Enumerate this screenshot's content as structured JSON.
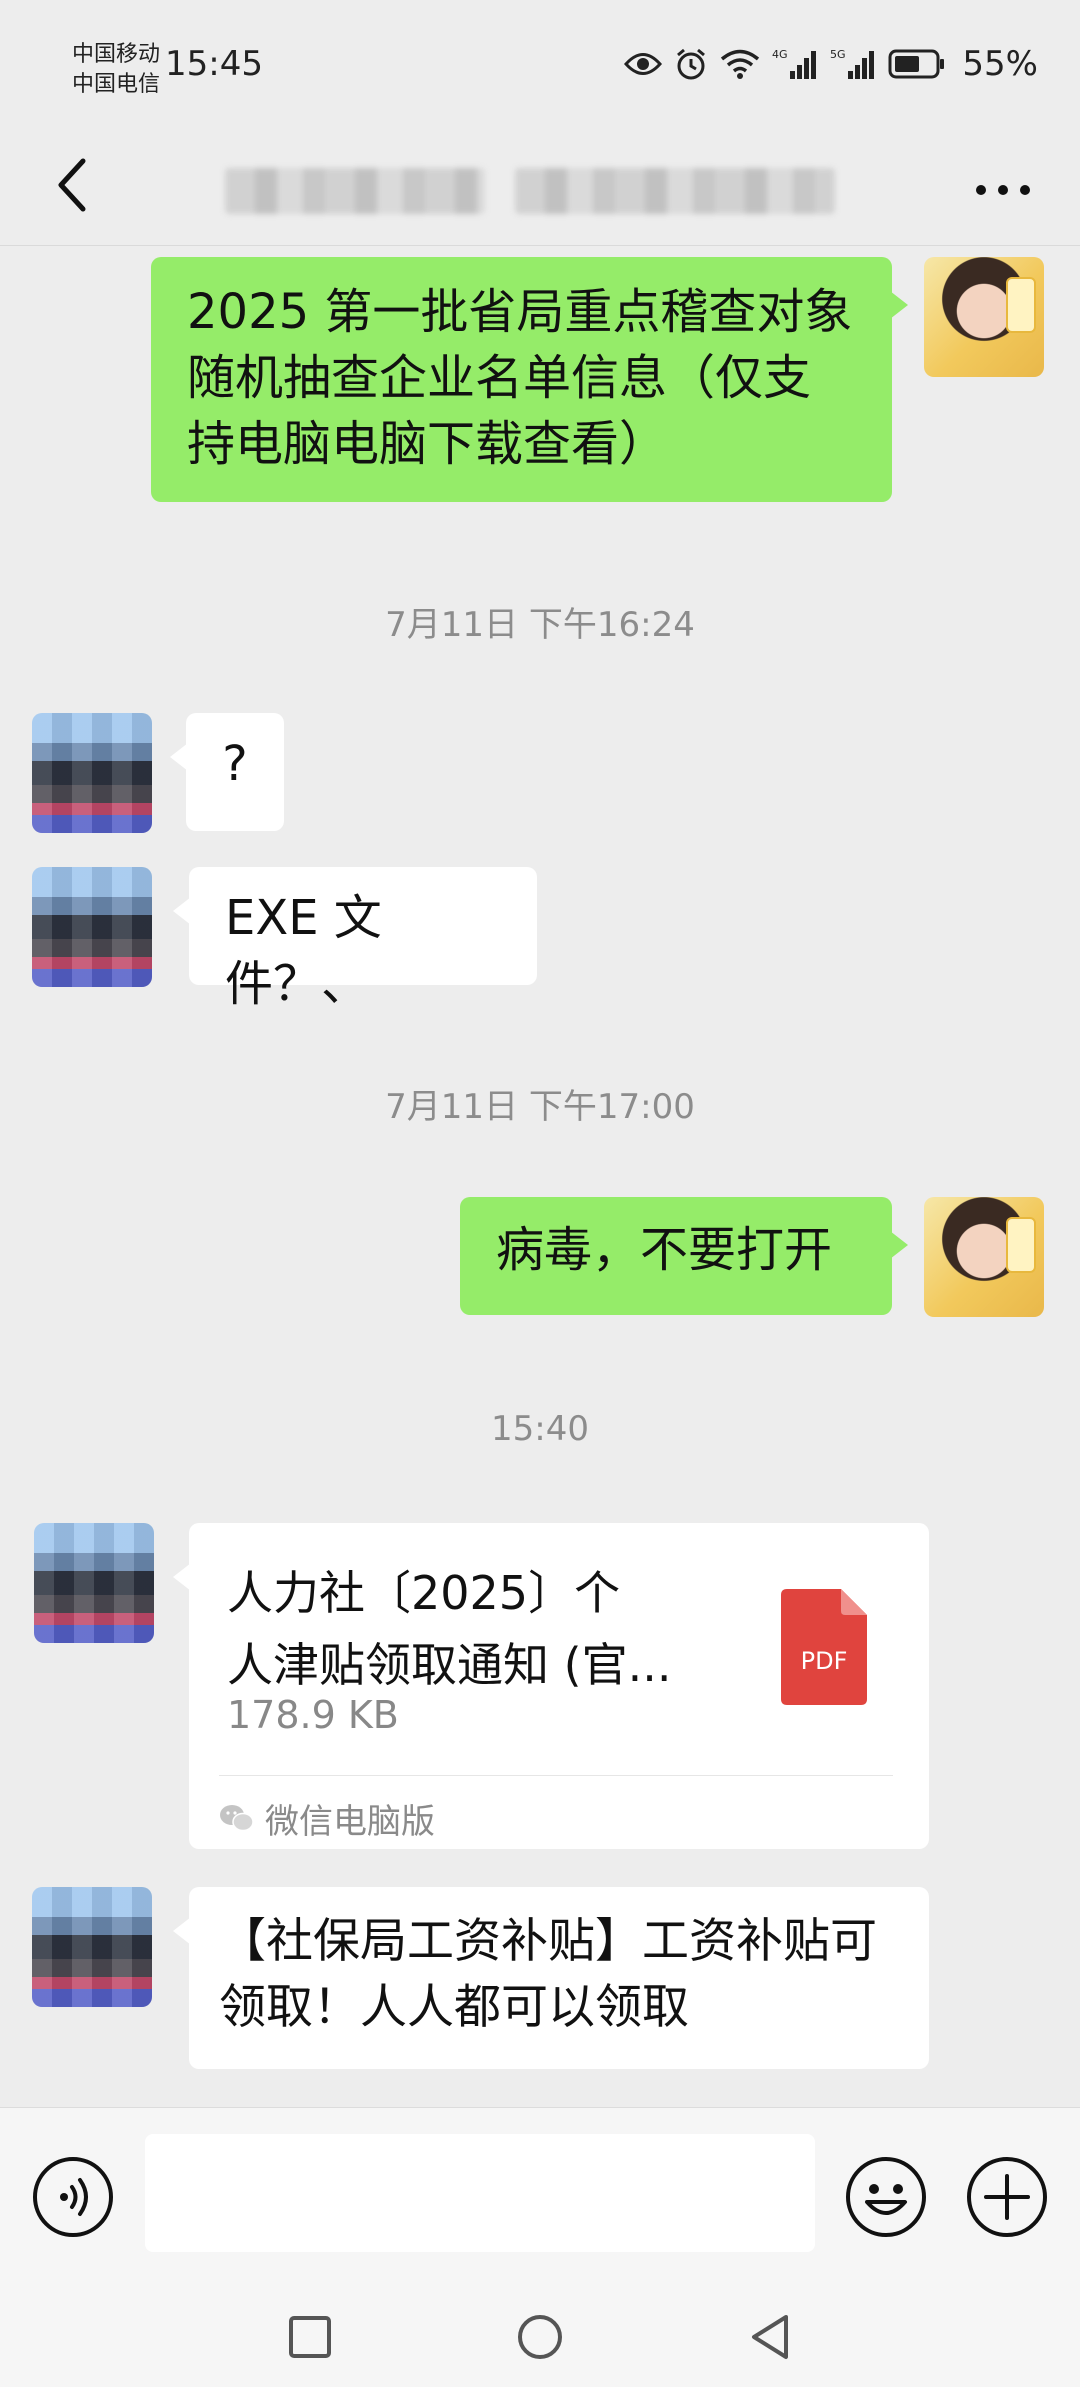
{
  "status_bar": {
    "carrier1": "中国移动",
    "carrier2": "中国电信",
    "time": "15:45",
    "battery": "55%",
    "icons": [
      "eye-icon",
      "alarm-icon",
      "wifi-icon",
      "signal-4g-icon",
      "signal-5g-icon",
      "battery-icon"
    ]
  },
  "nav": {
    "back_icon": "chevron-left-icon",
    "more_icon": "more-dots-icon"
  },
  "messages": [
    {
      "side": "self",
      "type": "text",
      "text": "2025 第一批省局重点稽查对象随机抽查企业名单信息（仅支持电脑电脑下载查看）"
    },
    {
      "type": "time",
      "text": "7月11日 下午16:24"
    },
    {
      "side": "other",
      "type": "text",
      "text": "?"
    },
    {
      "side": "other",
      "type": "text",
      "text": "EXE 文件？、"
    },
    {
      "type": "time",
      "text": "7月11日 下午17:00"
    },
    {
      "side": "self",
      "type": "text",
      "text": "病毒，不要打开"
    },
    {
      "type": "time",
      "text": "15:40"
    },
    {
      "side": "other",
      "type": "file",
      "file_name_line1": "人力社〔2025〕个",
      "file_name_line2": "人津贴领取通知 (官...",
      "file_size": "178.9 KB",
      "file_type": "PDF",
      "source": "微信电脑版"
    },
    {
      "side": "other",
      "type": "text",
      "text": "【社保局工资补贴】工资补贴可领取！人人都可以领取"
    }
  ],
  "input_bar": {
    "voice_icon": "voice-icon",
    "emoji_icon": "emoji-icon",
    "plus_icon": "plus-icon",
    "input_value": ""
  },
  "system_nav": [
    "recent-apps-icon",
    "home-icon",
    "back-icon"
  ],
  "colors": {
    "background": "#ededed",
    "self_bubble": "#95ec69",
    "other_bubble": "#ffffff",
    "pdf_red": "#e0443e"
  }
}
